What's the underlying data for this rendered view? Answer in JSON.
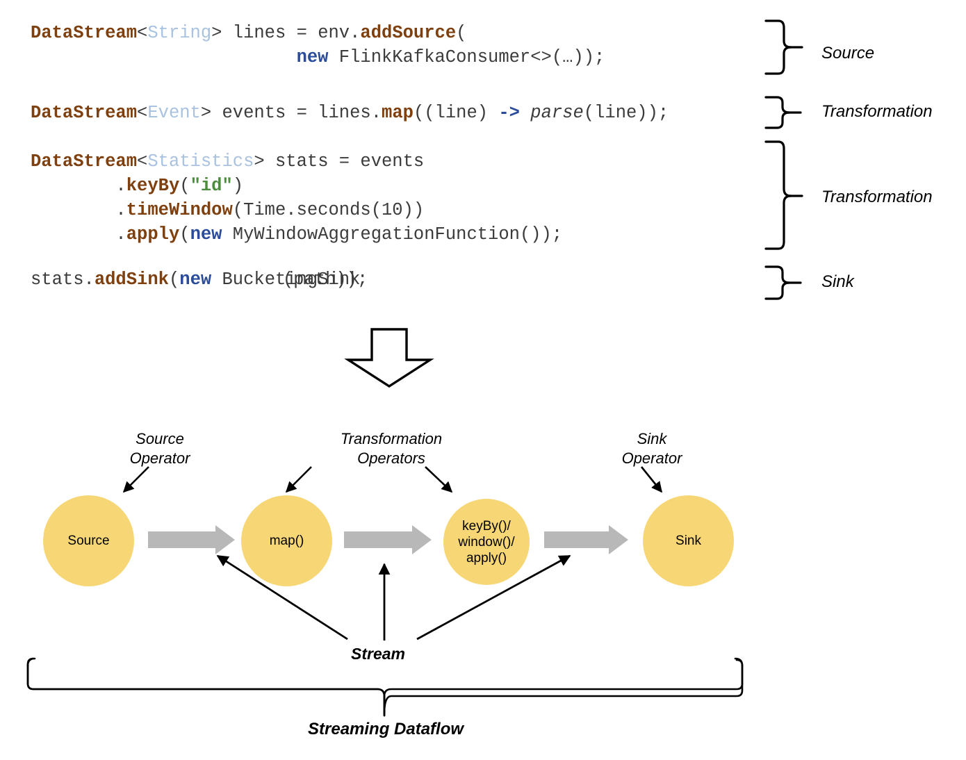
{
  "code": {
    "blocks": [
      {
        "id": "source-block",
        "lines": [
          [
            {
              "t": "DataStream",
              "c": "kw-type"
            },
            {
              "t": "<",
              "c": "plain"
            },
            {
              "t": "String",
              "c": "kw-generic"
            },
            {
              "t": "> lines = env.",
              "c": "plain"
            },
            {
              "t": "addSource",
              "c": "kw-method"
            },
            {
              "t": "(",
              "c": "plain"
            }
          ],
          [
            {
              "t": "                         ",
              "c": "plain"
            },
            {
              "t": "new",
              "c": "kw-new"
            },
            {
              "t": " FlinkKafkaConsumer<>(…));",
              "c": "plain"
            }
          ]
        ]
      },
      {
        "id": "map-block",
        "lines": [
          [
            {
              "t": "DataStream",
              "c": "kw-type"
            },
            {
              "t": "<",
              "c": "plain"
            },
            {
              "t": "Event",
              "c": "kw-generic"
            },
            {
              "t": "> events = lines.",
              "c": "plain"
            },
            {
              "t": "map",
              "c": "kw-method"
            },
            {
              "t": "((line) ",
              "c": "plain"
            },
            {
              "t": "->",
              "c": "kw-arrow"
            },
            {
              "t": " ",
              "c": "plain"
            },
            {
              "t": "parse",
              "c": "kw-italic"
            },
            {
              "t": "(line));",
              "c": "plain"
            }
          ]
        ]
      },
      {
        "id": "window-block",
        "lines": [
          [
            {
              "t": "DataStream",
              "c": "kw-type"
            },
            {
              "t": "<",
              "c": "plain"
            },
            {
              "t": "Statistics",
              "c": "kw-generic"
            },
            {
              "t": "> stats = events",
              "c": "plain"
            }
          ],
          [
            {
              "t": "        .",
              "c": "plain"
            },
            {
              "t": "keyBy",
              "c": "kw-method"
            },
            {
              "t": "(",
              "c": "plain"
            },
            {
              "t": "\"id\"",
              "c": "kw-string"
            },
            {
              "t": ")",
              "c": "plain"
            }
          ],
          [
            {
              "t": "        .",
              "c": "plain"
            },
            {
              "t": "timeWindow",
              "c": "kw-method"
            },
            {
              "t": "(Time.seconds(10))",
              "c": "plain"
            }
          ],
          [
            {
              "t": "        .",
              "c": "plain"
            },
            {
              "t": "apply",
              "c": "kw-method"
            },
            {
              "t": "(",
              "c": "plain"
            },
            {
              "t": "new",
              "c": "kw-new"
            },
            {
              "t": " MyWindowAggregationFunction());",
              "c": "plain"
            }
          ]
        ]
      },
      {
        "id": "sink-block",
        "overlap": true,
        "lines": [
          [
            {
              "t": "stats.",
              "c": "plain"
            },
            {
              "t": "addSink",
              "c": "kw-method"
            },
            {
              "t": "(",
              "c": "plain"
            },
            {
              "t": "new",
              "c": "kw-new"
            },
            {
              "t": " BucketingSink",
              "c": "plain"
            }
          ]
        ],
        "overlap_text": "                          (path));"
      }
    ]
  },
  "brace_labels": {
    "source": "Source",
    "transformation_1": "Transformation",
    "transformation_2": "Transformation",
    "sink": "Sink"
  },
  "dataflow": {
    "nodes": [
      {
        "id": "source",
        "label": "Source"
      },
      {
        "id": "map",
        "label": "map()"
      },
      {
        "id": "keyby",
        "label": "keyBy()/\nwindow()/\napply()"
      },
      {
        "id": "sink",
        "label": "Sink"
      }
    ],
    "annotations": [
      {
        "id": "source-operator",
        "text": "Source\nOperator"
      },
      {
        "id": "transformation-operators",
        "text": "Transformation\nOperators"
      },
      {
        "id": "sink-operator",
        "text": "Sink\nOperator"
      }
    ],
    "stream_label": "Stream",
    "bottom_label": "Streaming Dataflow"
  },
  "colors": {
    "node_fill": "#f7d676",
    "flow_arrow": "#b8b8b8",
    "stroke": "#000000",
    "type_keyword": "#7f4010",
    "generic_type": "#a9c2e0",
    "language_keyword": "#2b4c9b",
    "string_literal": "#4e8c3f"
  }
}
